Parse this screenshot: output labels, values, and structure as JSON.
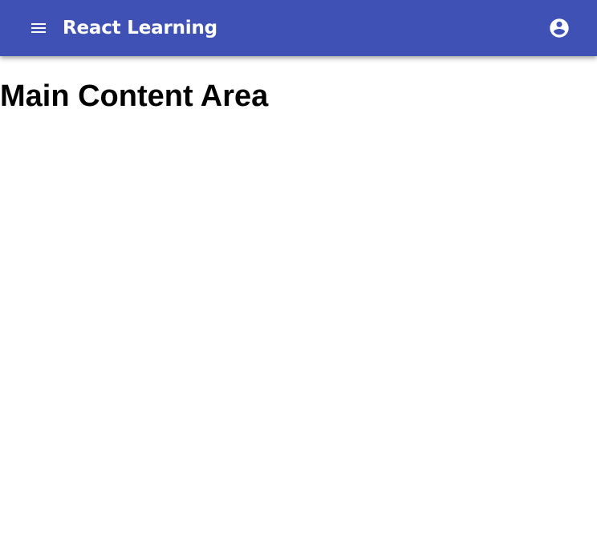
{
  "app_bar": {
    "title": "React Learning",
    "background_color": "#3f51b5",
    "text_color": "#ffffff",
    "menu_icon": "menu-icon",
    "account_icon": "account-circle-icon"
  },
  "main": {
    "heading": "Main Content Area"
  }
}
